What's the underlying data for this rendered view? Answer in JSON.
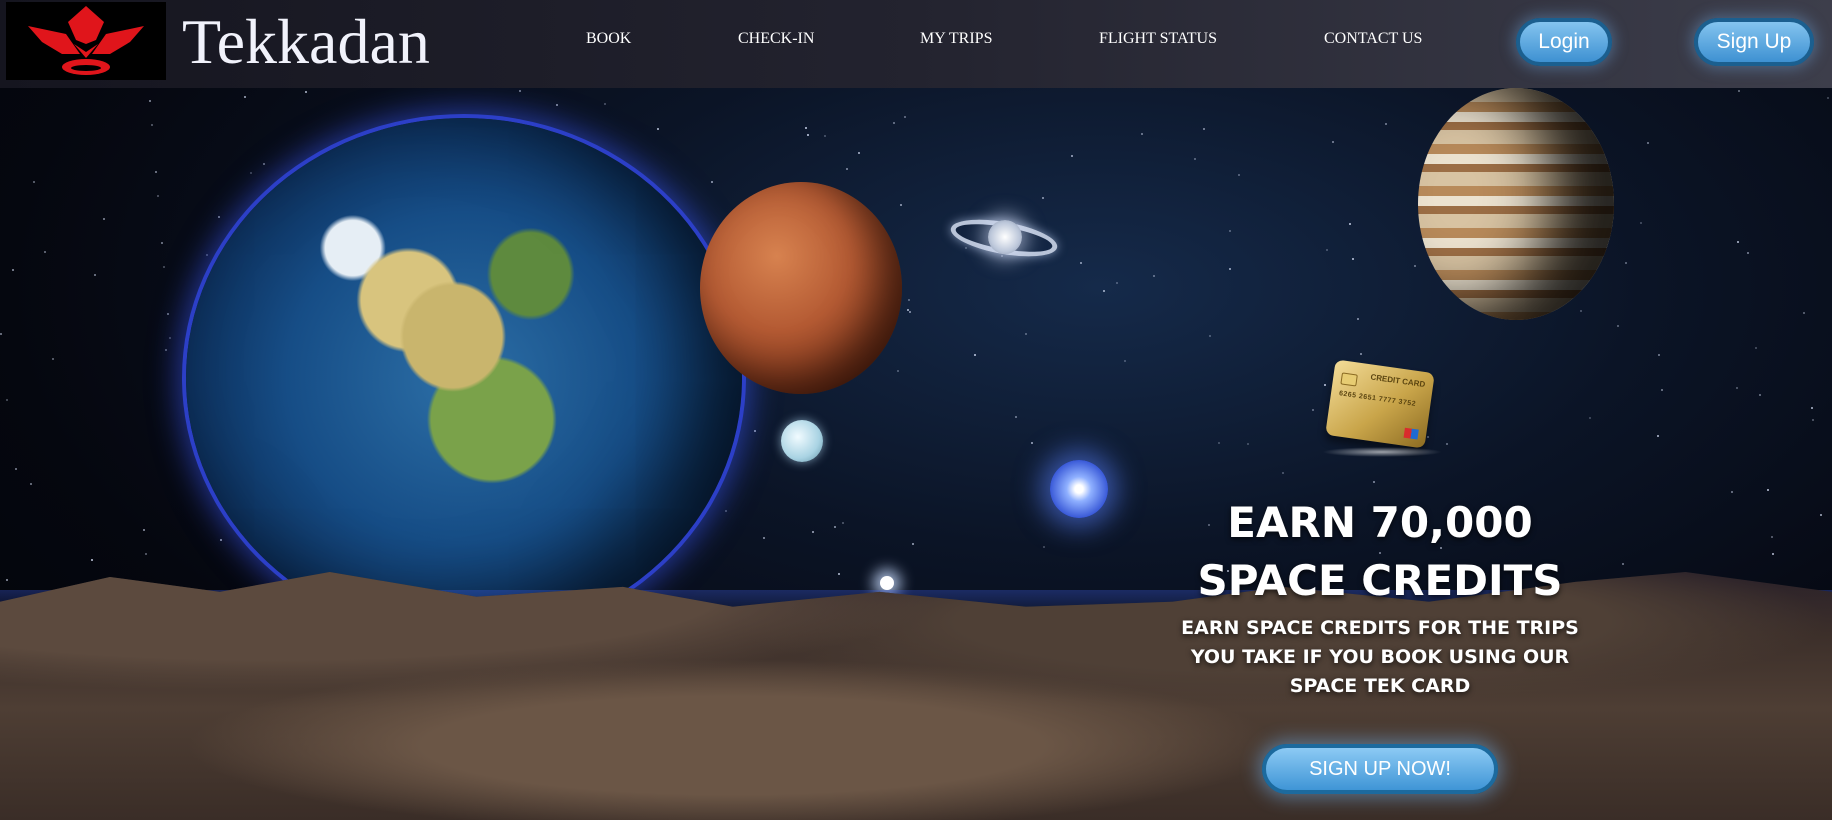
{
  "header": {
    "brand": "Tekkadan",
    "nav": [
      {
        "label": "BOOK"
      },
      {
        "label": "CHECK-IN"
      },
      {
        "label": "MY TRIPS"
      },
      {
        "label": "FLIGHT STATUS"
      },
      {
        "label": "CONTACT US"
      }
    ],
    "login_label": "Login",
    "signup_label": "Sign Up"
  },
  "hero": {
    "card_brand": "CREDIT CARD",
    "card_number": "6265 2651 7777 3752",
    "headline_line1": "EARN 70,000",
    "headline_line2": "SPACE CREDITS",
    "subtext": "EARN SPACE CREDITS FOR THE TRIPS YOU TAKE IF YOU BOOK USING OUR SPACE TEK CARD",
    "cta_label": "SIGN UP NOW!"
  },
  "colors": {
    "header_bg": "#23232f",
    "button_blue": "#3e91d2",
    "button_border": "#1b5f8f",
    "logo_red": "#e0151b"
  },
  "icons": {
    "logo": "red-lotus-logo-icon"
  }
}
